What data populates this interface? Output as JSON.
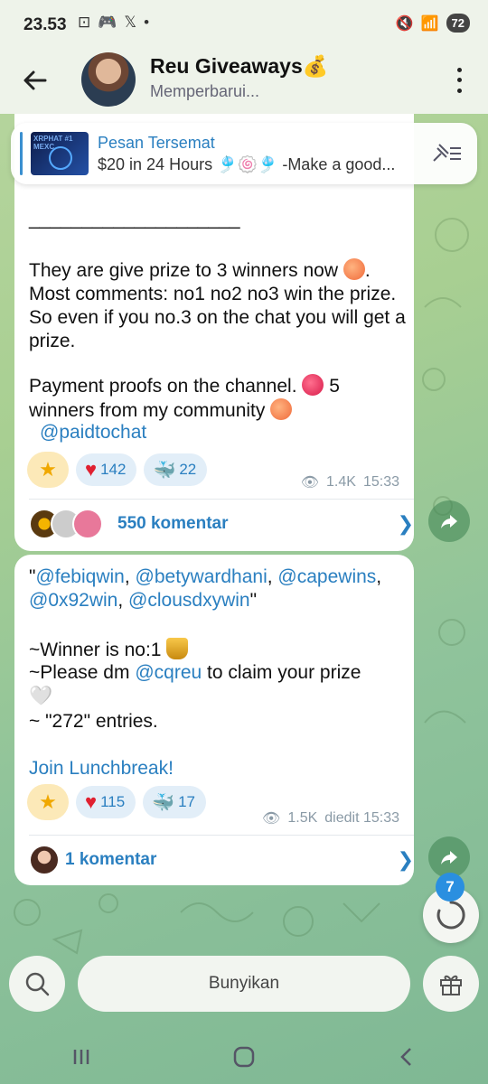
{
  "status_bar": {
    "time": "23.53",
    "battery": "72"
  },
  "header": {
    "title": "Reu Giveaways💰",
    "subtitle": "Memperbarui..."
  },
  "pinned": {
    "title": "Pesan Tersemat",
    "text": "$20 in 24 Hours 🎐🍥🎐  -Make a good...",
    "thumb_text": "XRPHAT\n#1 MEXC"
  },
  "message1": {
    "separator": "____________________",
    "para1": "They are give prize to 3 winners now",
    "para1_rest": ". Most comments: no1 no2 no3 win the prize. So even if you no.3 on the chat you will get a prize.",
    "para2": "Payment proofs on the channel.",
    "para2_rest": " 5 winners from my community",
    "link": "@paidtochat",
    "reaction_heart": "142",
    "reaction_whale": "22",
    "views": "1.4K",
    "time": "15:33",
    "comments_label": "550 komentar"
  },
  "message2": {
    "mentions_open": "\"",
    "mention1": "@febiqwin",
    "mention2": "@betywardhani",
    "mention3": "@capewins",
    "mention4": "@0x92win",
    "mention5": "@clousdxywin",
    "mentions_close": "\"",
    "winner_line": "~Winner is no:1",
    "dm_prefix": "~Please dm ",
    "dm_link": "@cqreu",
    "dm_suffix": " to claim your prize",
    "entries": "~ \"272\" entries.",
    "join_link": "Join Lunchbreak!",
    "reaction_heart": "115",
    "reaction_whale": "17",
    "views": "1.5K",
    "edited_time": "diedit 15:33",
    "comments_label": "1 komentar"
  },
  "unread_count": "7",
  "bottom": {
    "mute_label": "Bunyikan"
  },
  "colors": {
    "accent": "#2a7fc0",
    "bubble": "#ffffff",
    "bg": "#a8cf92"
  }
}
